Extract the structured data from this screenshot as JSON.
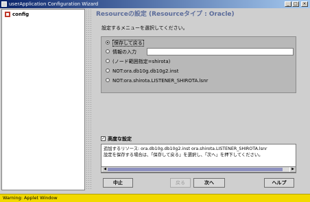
{
  "window": {
    "title": "userApplication Configuration Wizard",
    "controls": [
      "_",
      "□",
      "×"
    ]
  },
  "tree": {
    "root_label": "config"
  },
  "panel": {
    "title": "Resourceの設定 (Resourceタイプ : Oracle)",
    "subtitle": "設定するメニューを選択してください。"
  },
  "options": [
    {
      "label": "保存して戻る",
      "selected": true
    },
    {
      "label": "情報の入力",
      "selected": false
    },
    {
      "label": "(ノード範囲指定=shirota)",
      "selected": false
    },
    {
      "label": "NOT:ora.db10g.db10g2.inst",
      "selected": false
    },
    {
      "label": "NOT:ora.shirota.LISTENER_SHIROTA.lsnr",
      "selected": false
    }
  ],
  "advanced": {
    "checked": true,
    "label": "高度な設定",
    "mark": "✓"
  },
  "message": {
    "line1": "追加するリソース: ora.db10g.db10g2.inst ora.shirota.LISTENER_SHIROTA.lsnr",
    "line2": "設定を保存する場合は、「保存して戻る」を選択し、「次へ」を押下してください。"
  },
  "scroll": {
    "left": "◀",
    "right": "▶"
  },
  "buttons": {
    "cancel": "中止",
    "back": "戻る",
    "next": "次へ",
    "help": "ヘルプ"
  },
  "status": "Warning: Applet Window"
}
